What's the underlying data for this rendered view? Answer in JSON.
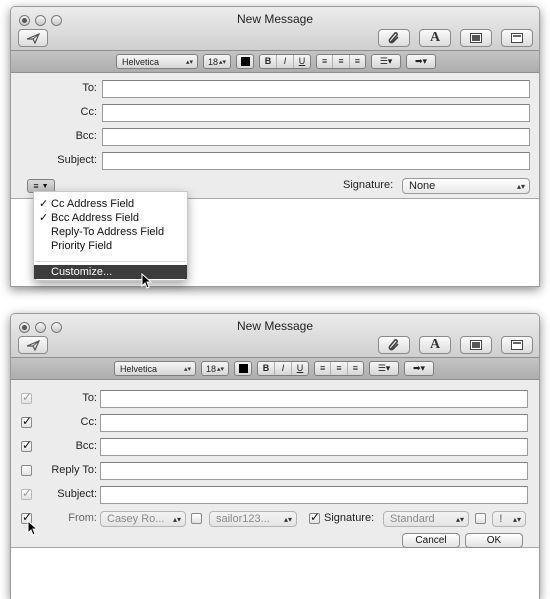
{
  "window_top": {
    "title": "New Message",
    "toolbar": {
      "send_icon": "paper-plane-icon",
      "right_icons": [
        "paperclip-icon",
        "fonts-icon",
        "photo-browser-icon",
        "stationery-icon"
      ],
      "fonts_glyph": "A"
    },
    "format_bar": {
      "font": "Helvetica",
      "size": "18",
      "bold": "B",
      "italic": "I",
      "underline": "U"
    },
    "fields": [
      {
        "label": "To:",
        "value": ""
      },
      {
        "label": "Cc:",
        "value": ""
      },
      {
        "label": "Bcc:",
        "value": ""
      },
      {
        "label": "Subject:",
        "value": ""
      }
    ],
    "signature_label": "Signature:",
    "signature_value": "None",
    "menu": {
      "items": [
        {
          "label": "Cc Address Field",
          "checked": true,
          "check": "✓"
        },
        {
          "label": "Bcc Address Field",
          "checked": true,
          "check": "✓"
        },
        {
          "label": "Reply-To Address Field",
          "checked": false,
          "check": ""
        },
        {
          "label": "Priority Field",
          "checked": false,
          "check": ""
        }
      ],
      "customize": "Customize..."
    }
  },
  "window_bottom": {
    "title": "New Message",
    "format_bar": {
      "font": "Helvetica",
      "size": "18",
      "bold": "B",
      "italic": "I",
      "underline": "U"
    },
    "fields": [
      {
        "label": "To:",
        "value": "",
        "checked": true,
        "enabled": false
      },
      {
        "label": "Cc:",
        "value": "",
        "checked": true,
        "enabled": true
      },
      {
        "label": "Bcc:",
        "value": "",
        "checked": true,
        "enabled": true
      },
      {
        "label": "Reply To:",
        "value": "",
        "checked": false,
        "enabled": true
      },
      {
        "label": "Subject:",
        "value": "",
        "checked": true,
        "enabled": false
      }
    ],
    "from": {
      "checked": true,
      "label": "From:",
      "value": "Casey Ro...",
      "account_checked": false,
      "account_value": "sailor123..."
    },
    "signature": {
      "checked": true,
      "label": "Signature:",
      "value": "Standard"
    },
    "priority": {
      "checked": false,
      "value": "!"
    },
    "cancel_label": "Cancel",
    "ok_label": "OK"
  }
}
